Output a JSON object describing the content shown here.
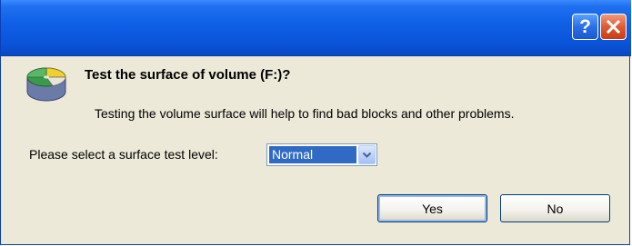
{
  "titlebar": {
    "help_label": "?",
    "close_icon": "close-icon"
  },
  "dialog": {
    "icon": "disk-icon",
    "heading": "Test the surface of volume (F:)?",
    "description": "Testing the volume surface will help to find bad blocks and other problems.",
    "select_label": "Please select a surface test level:",
    "select_value": "Normal",
    "buttons": {
      "yes": "Yes",
      "no": "No"
    }
  },
  "colors": {
    "titlebar": "#0a53d8",
    "dialog_bg": "#ece9d8",
    "selection": "#316ac5",
    "close_button": "#e05a32"
  }
}
